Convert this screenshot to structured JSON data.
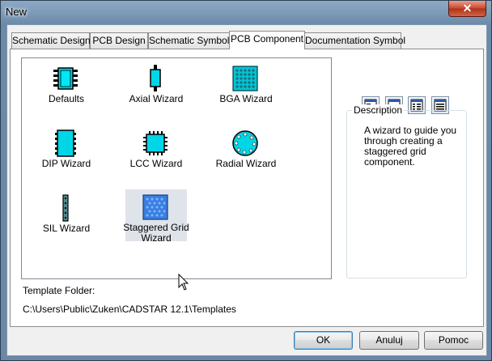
{
  "window": {
    "title": "New",
    "close_glyph": "✕"
  },
  "tabs": [
    {
      "label": "Schematic Design",
      "active": false
    },
    {
      "label": "PCB Design",
      "active": false
    },
    {
      "label": "Schematic Symbol",
      "active": false
    },
    {
      "label": "PCB Component",
      "active": true
    },
    {
      "label": "Documentation Symbol",
      "active": false
    }
  ],
  "templates": [
    {
      "label": "Defaults",
      "icon": "chip-icon"
    },
    {
      "label": "Axial Wizard",
      "icon": "axial-component-icon"
    },
    {
      "label": "BGA Wizard",
      "icon": "bga-grid-icon"
    },
    {
      "label": "DIP Wizard",
      "icon": "dip-component-icon"
    },
    {
      "label": "LCC Wizard",
      "icon": "lcc-component-icon"
    },
    {
      "label": "Radial Wizard",
      "icon": "radial-component-icon"
    },
    {
      "label": "SIL Wizard",
      "icon": "sil-component-icon"
    },
    {
      "label": "Staggered Grid Wizard",
      "icon": "staggered-grid-icon",
      "selected": true
    }
  ],
  "view_buttons": [
    "large-icons-view-icon",
    "small-icons-view-icon",
    "list-view-icon",
    "details-view-icon"
  ],
  "description": {
    "title": "Description",
    "text": "A wizard to guide you through creating a staggered grid component."
  },
  "template_folder": {
    "label": "Template Folder:",
    "path": "C:\\Users\\Public\\Zuken\\CADSTAR 12.1\\Templates"
  },
  "buttons": {
    "ok": "OK",
    "cancel": "Anuluj",
    "help": "Pomoc"
  },
  "colors": {
    "accent": "#00d6e6",
    "selection": "#dfe3ea",
    "default_button_border": "#3c7fb1"
  }
}
